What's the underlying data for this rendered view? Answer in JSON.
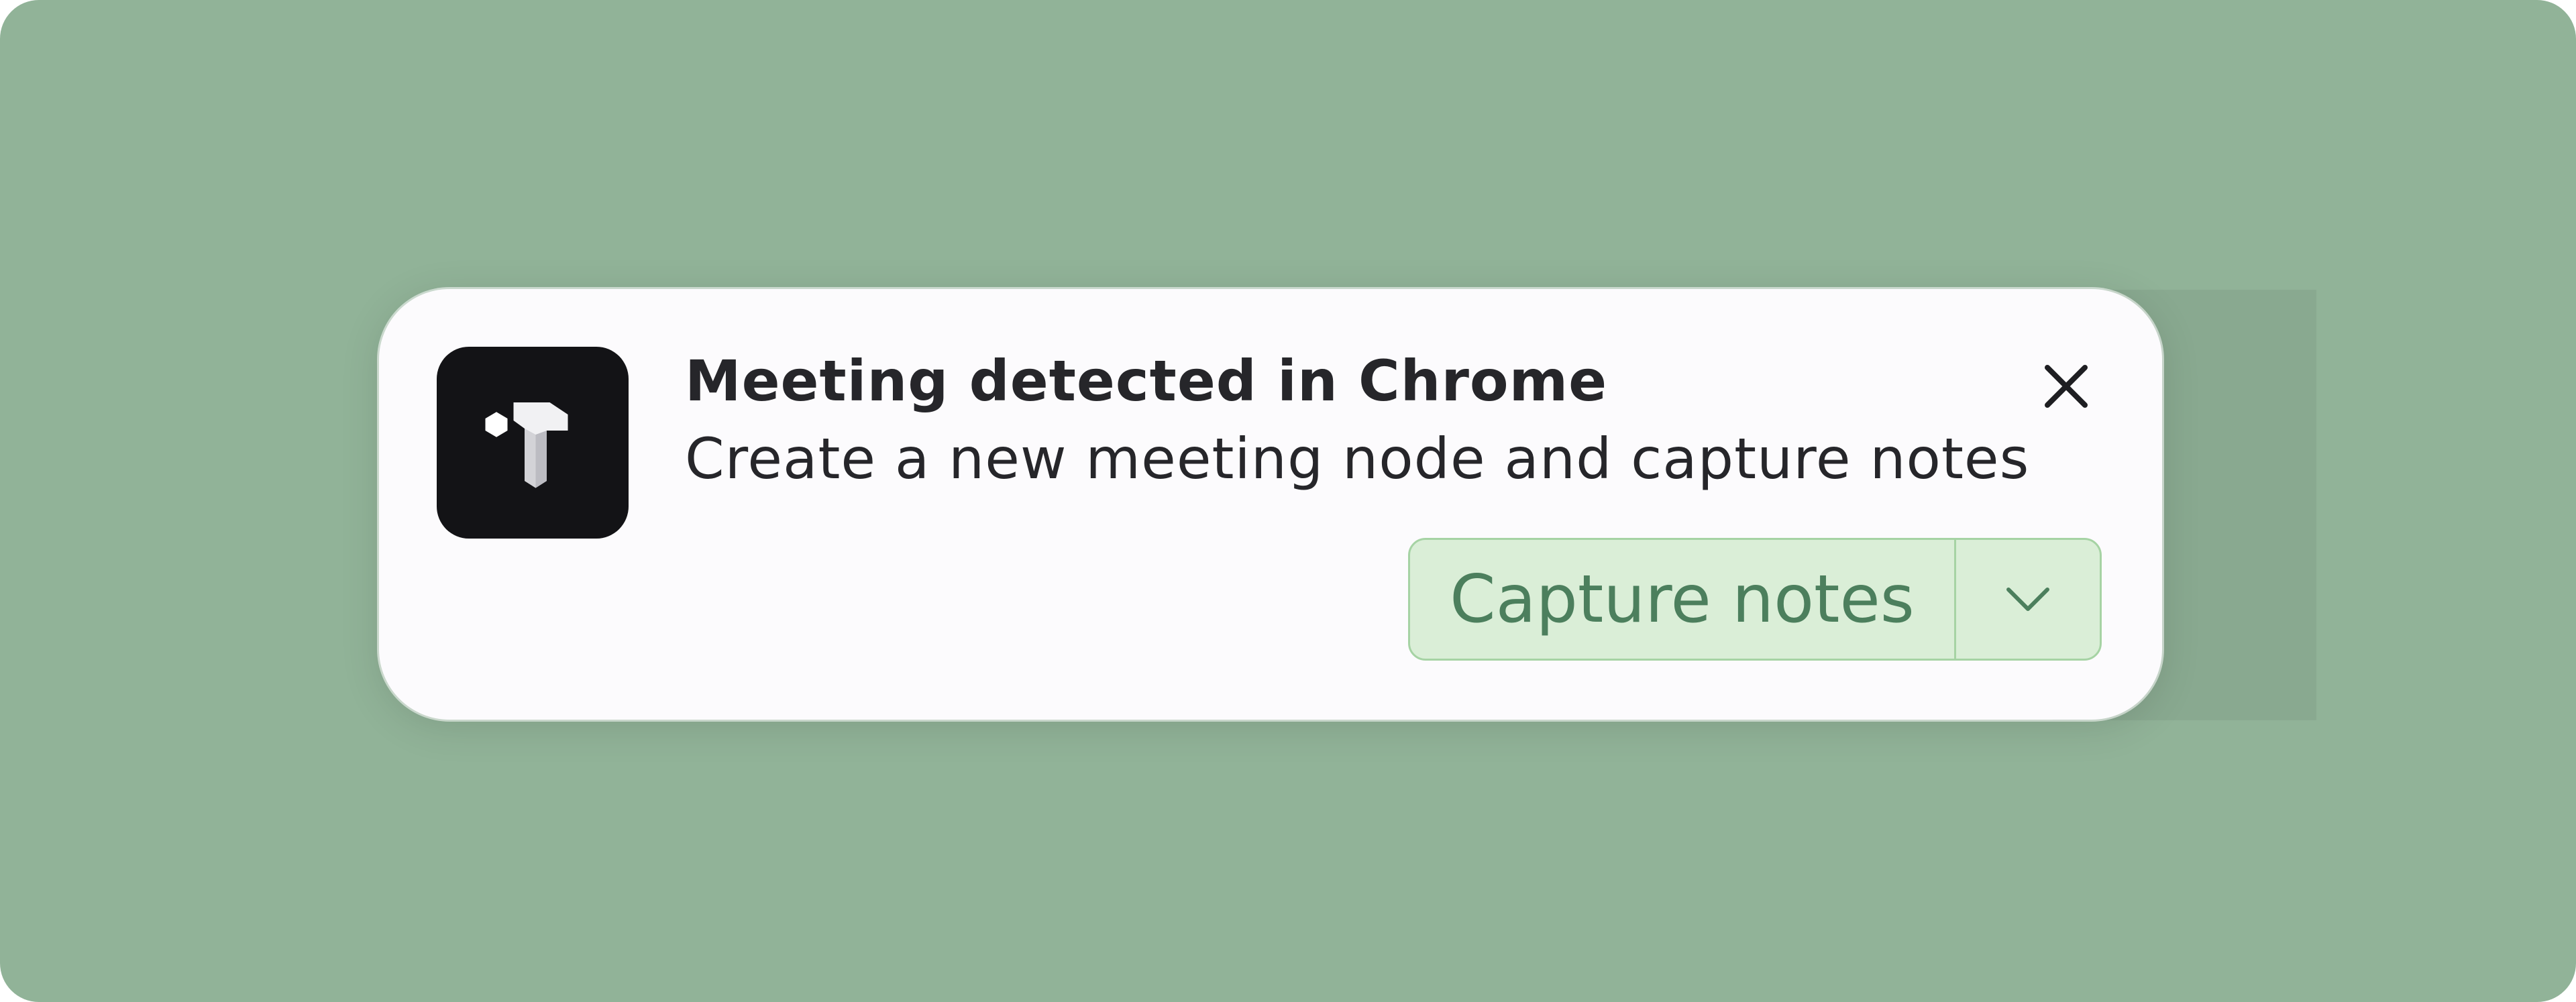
{
  "colors": {
    "background": "#91b398",
    "toast_bg": "#fcfbfd",
    "icon_bg": "#131316",
    "text": "#26262a",
    "button_bg": "#daeed7",
    "button_border": "#a6d3a4",
    "button_text": "#4c7f5d"
  },
  "notification": {
    "app_icon": "tana-logo-icon",
    "title": "Meeting detected in Chrome",
    "message": "Create a new meeting node and capture notes",
    "close_icon": "close-icon",
    "primary_action": {
      "label": "Capture notes"
    },
    "dropdown_icon": "chevron-down-icon"
  }
}
